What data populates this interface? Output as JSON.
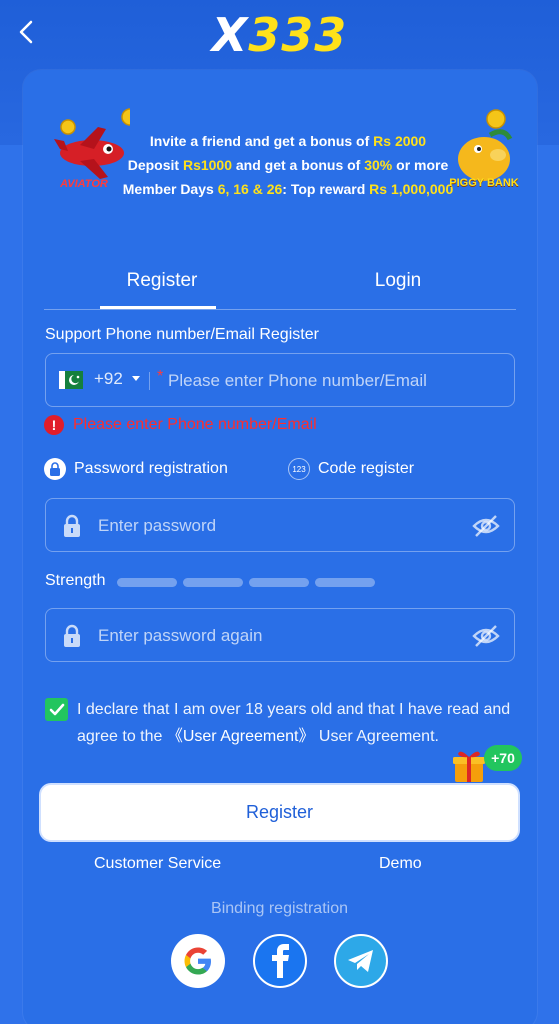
{
  "header": {
    "logo_x": "X",
    "logo_num": "333"
  },
  "banner": {
    "aviator_text": "AVIATOR",
    "piggy_text": "PIGGY BANK",
    "line1_a": "Invite a friend and get a bonus of ",
    "line1_b": "Rs 2000",
    "line2_a": "Deposit ",
    "line2_b": "Rs1000",
    "line2_c": " and get a bonus of ",
    "line2_d": "30%",
    "line2_e": " or more",
    "line3_a": "Member Days ",
    "line3_b": "6, 16 & 26",
    "line3_c": ": Top reward ",
    "line3_d": "Rs 1,000,000"
  },
  "tabs": {
    "register": "Register",
    "login": "Login"
  },
  "form": {
    "support_label": "Support Phone number/Email Register",
    "country_code": "+92",
    "required_mark": "*",
    "phone_placeholder": "Please enter Phone number/Email",
    "error_text": "Please enter Phone number/Email",
    "method_password": "Password registration",
    "method_code": "Code register",
    "code_icon_text": "123",
    "password_placeholder": "Enter password",
    "strength_label": "Strength",
    "password_again_placeholder": "Enter password again",
    "declare_text": "I declare that I am over 18 years old and that I have read and agree to the ",
    "agreement_link": "《User Agreement》",
    "declare_suffix": " User Agreement.",
    "bonus": "+70",
    "register_button": "Register"
  },
  "footer": {
    "customer_service": "Customer Service",
    "demo": "Demo",
    "binding": "Binding registration"
  },
  "colors": {
    "background": "#2f72ea",
    "accent_yellow": "#ffe11a",
    "error_red": "#ff2d2d",
    "checkbox_green": "#22c55e",
    "button_text": "#1f5fd8"
  }
}
